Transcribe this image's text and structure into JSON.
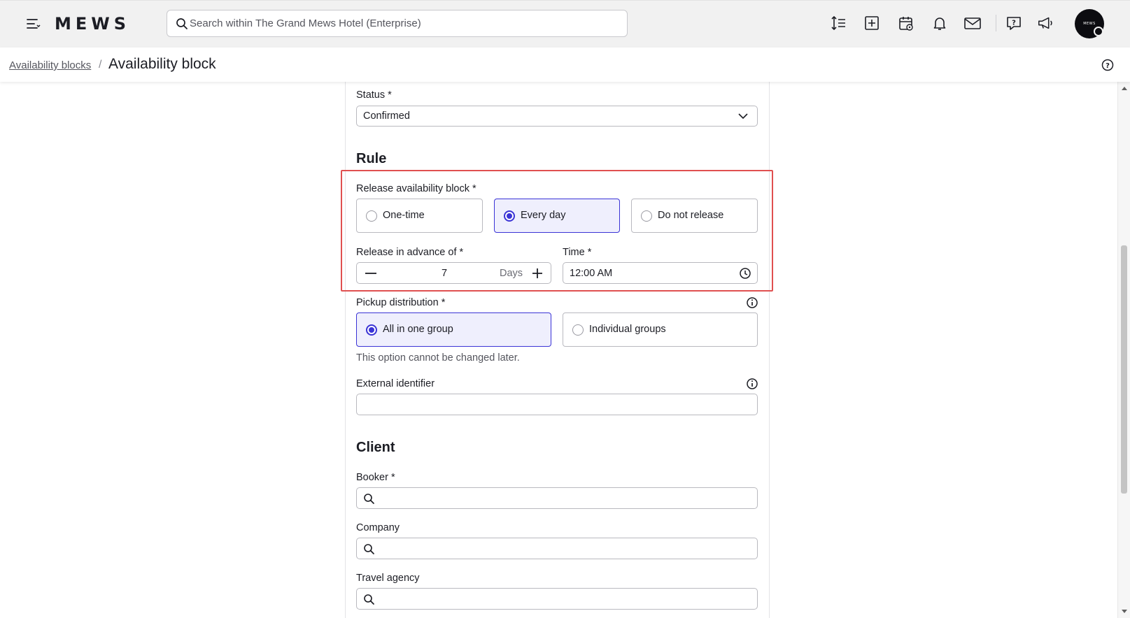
{
  "header": {
    "logo": "MEWS",
    "search_placeholder": "Search within The Grand Mews Hotel (Enterprise)",
    "avatar_text": "MEWS"
  },
  "breadcrumb": {
    "parent": "Availability blocks",
    "separator": "/",
    "current": "Availability block"
  },
  "form": {
    "status": {
      "label": "Status *",
      "value": "Confirmed"
    },
    "rule_title": "Rule",
    "release": {
      "label": "Release availability block *",
      "options": [
        {
          "label": "One-time",
          "selected": false
        },
        {
          "label": "Every day",
          "selected": true
        },
        {
          "label": "Do not release",
          "selected": false
        }
      ]
    },
    "advance": {
      "label": "Release in advance of *",
      "value": "7",
      "unit": "Days"
    },
    "time": {
      "label": "Time *",
      "value": "12:00 AM"
    },
    "pickup": {
      "label": "Pickup distribution *",
      "options": [
        {
          "label": "All in one group",
          "selected": true
        },
        {
          "label": "Individual groups",
          "selected": false
        }
      ],
      "hint": "This option cannot be changed later."
    },
    "external_identifier": {
      "label": "External identifier",
      "value": ""
    },
    "client_title": "Client",
    "booker": {
      "label": "Booker *",
      "value": ""
    },
    "company": {
      "label": "Company",
      "value": ""
    },
    "travel_agency": {
      "label": "Travel agency",
      "value": ""
    }
  },
  "colors": {
    "accent": "#3a33d6",
    "selected_bg": "#efeffd",
    "highlight": "#e05050",
    "topbar_bg": "#f1f1f1"
  }
}
